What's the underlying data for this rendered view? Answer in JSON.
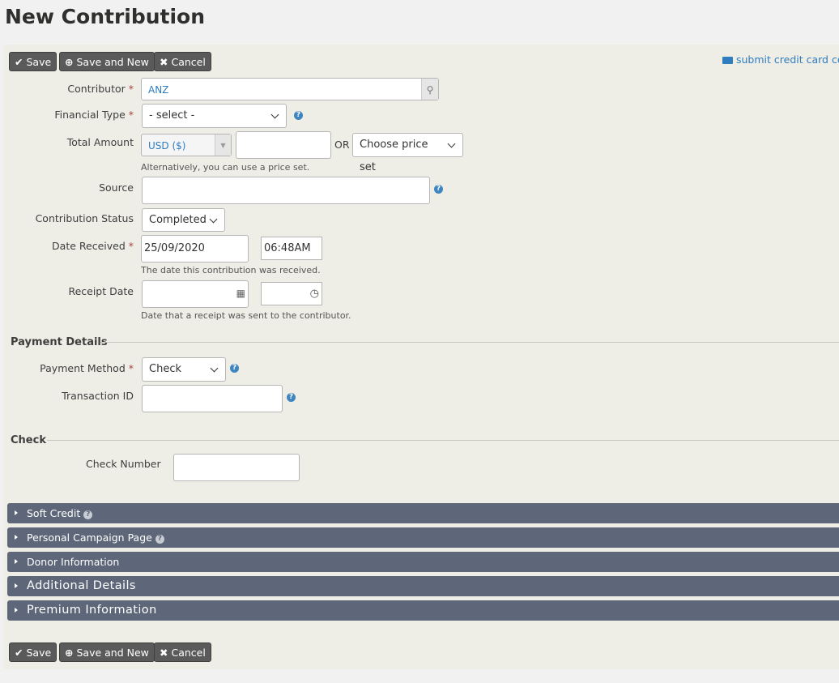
{
  "page": {
    "title": "New Contribution"
  },
  "toolbar": {
    "save": "Save",
    "save_new": "Save and New",
    "cancel": "Cancel",
    "credit_card_link": "submit credit card cont"
  },
  "form": {
    "contributor": {
      "label": "Contributor",
      "value": "ANZ"
    },
    "financial_type": {
      "label": "Financial Type",
      "value": "- select -"
    },
    "total_amount": {
      "label": "Total Amount",
      "currency": "USD ($)",
      "value": "",
      "or": "OR",
      "price_set": "Choose price set",
      "help": "Alternatively, you can use a price set."
    },
    "source": {
      "label": "Source",
      "value": ""
    },
    "status": {
      "label": "Contribution Status",
      "value": "Completed"
    },
    "date_received": {
      "label": "Date Received",
      "date": "25/09/2020",
      "time": "06:48AM",
      "help": "The date this contribution was received."
    },
    "receipt_date": {
      "label": "Receipt Date",
      "date": "",
      "time": "",
      "help": "Date that a receipt was sent to the contributor."
    }
  },
  "payment": {
    "heading": "Payment Details",
    "method_label": "Payment Method",
    "method": "Check",
    "transaction_label": "Transaction ID",
    "transaction": ""
  },
  "check": {
    "heading": "Check",
    "number_label": "Check Number",
    "number": ""
  },
  "accordions": [
    "Soft Credit",
    "Personal Campaign Page",
    "Donor Information",
    "Additional Details",
    "Premium Information"
  ],
  "colors": {
    "accordion": "#5d6779",
    "button": "#5a5a5a",
    "link": "#2f7dbf",
    "required": "#a94442"
  }
}
